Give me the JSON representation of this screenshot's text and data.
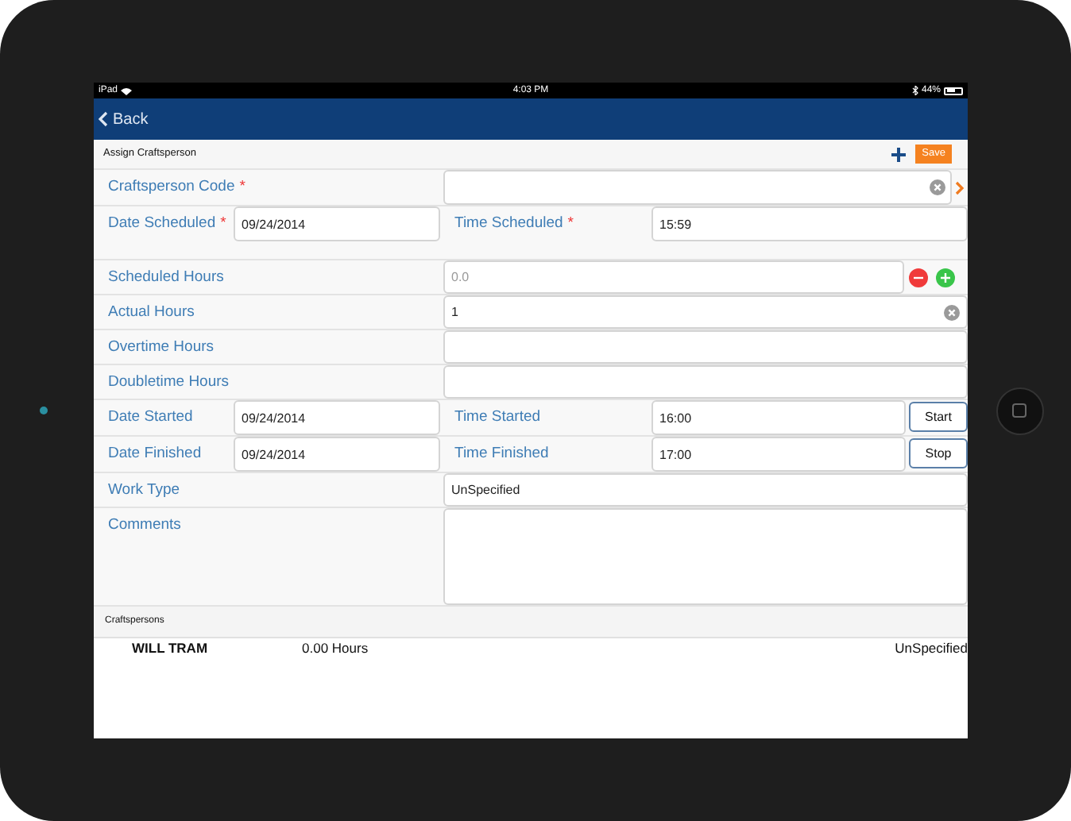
{
  "status_bar": {
    "device": "iPad",
    "time": "4:03 PM",
    "battery": "44%"
  },
  "nav": {
    "back": "Back"
  },
  "section": {
    "title": "Assign Craftsperson",
    "save": "Save"
  },
  "rows": [
    {
      "kind": "lookup",
      "label": "Craftsperson Code",
      "required_mark": "*",
      "clearable": true
    },
    {
      "kind": "date_time",
      "label": "Date Scheduled",
      "required_mark": "*",
      "date": "09/24/2014",
      "time_label": "Time Scheduled",
      "time_required_mark": "*",
      "time": "15:59"
    },
    {
      "kind": "stepper",
      "label": "Scheduled Hours",
      "placeholder": "0.0"
    },
    {
      "kind": "text",
      "label": "Actual Hours",
      "value": "1",
      "clearable": true
    },
    {
      "kind": "text",
      "label": "Overtime Hours"
    },
    {
      "kind": "text",
      "label": "Doubletime Hours"
    },
    {
      "kind": "date_time",
      "label": "Date Started",
      "date": "09/24/2014",
      "time_label": "Time Started",
      "time": "16:00",
      "button": "Start"
    },
    {
      "kind": "date_time",
      "label": "Date Finished",
      "date": "09/24/2014",
      "time_label": "Time Finished",
      "time": "17:00",
      "button": "Stop"
    },
    {
      "kind": "text",
      "label": "Work Type",
      "value": "UnSpecified"
    },
    {
      "kind": "textarea",
      "label": "Comments"
    }
  ],
  "craftspersons": {
    "title": "Craftspersons",
    "rows": [
      {
        "name": "WILL TRAM",
        "hours": "0.00 Hours",
        "work_type": "UnSpecified"
      }
    ]
  }
}
